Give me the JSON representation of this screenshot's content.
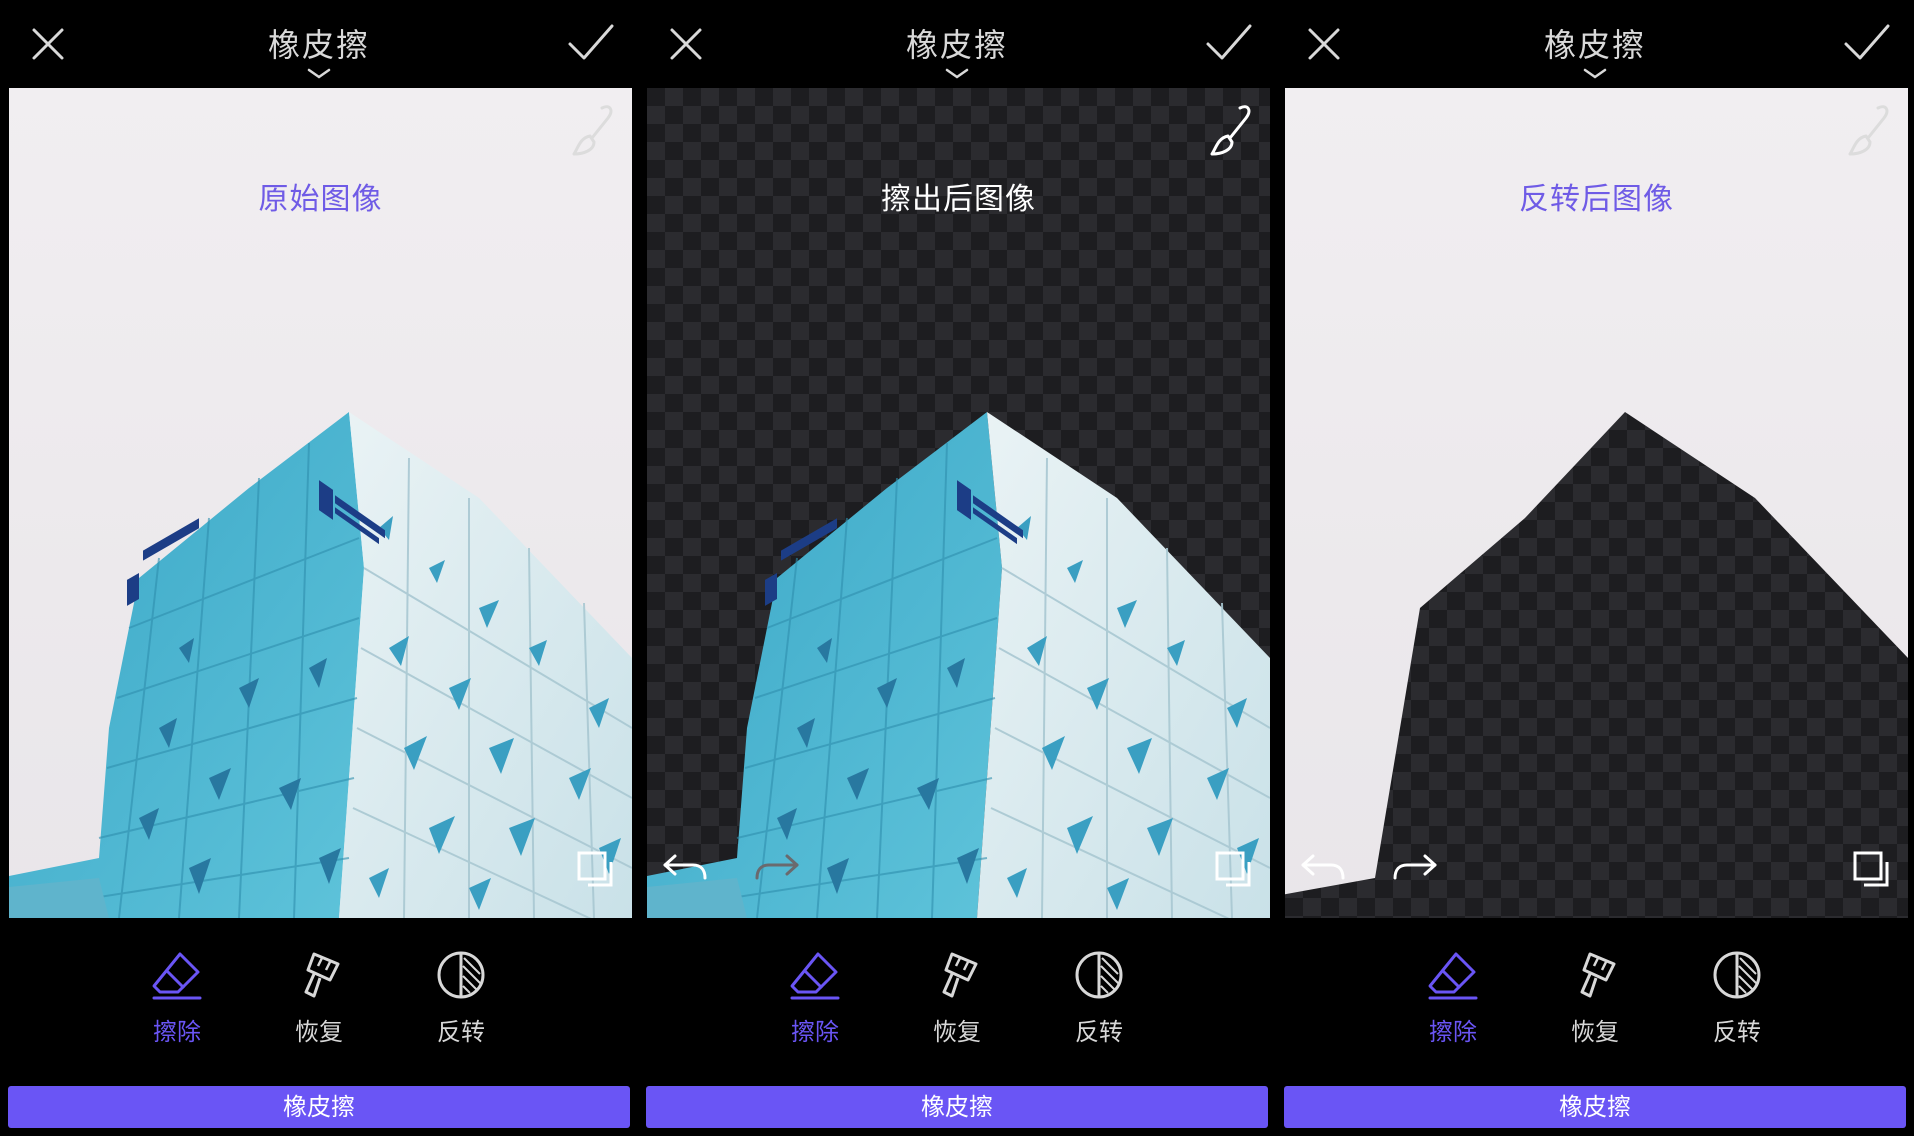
{
  "colors": {
    "accent": "#6a55f5",
    "label_purple": "#6f5be6",
    "icon_inactive": "#d8d8d8",
    "label_white": "#ffffff",
    "building_blue": "#4fb3cf",
    "building_light": "#d7e8ec"
  },
  "panels": [
    {
      "header_title": "橡皮擦",
      "canvas_label": "原始图像",
      "tools": [
        {
          "label": "擦除",
          "icon": "eraser-icon",
          "active": true
        },
        {
          "label": "恢复",
          "icon": "brush-restore-icon",
          "active": false
        },
        {
          "label": "反转",
          "icon": "invert-icon",
          "active": false
        }
      ],
      "bottom_label": "橡皮擦"
    },
    {
      "header_title": "橡皮擦",
      "canvas_label": "擦出后图像",
      "tools": [
        {
          "label": "擦除",
          "icon": "eraser-icon",
          "active": true
        },
        {
          "label": "恢复",
          "icon": "brush-restore-icon",
          "active": false
        },
        {
          "label": "反转",
          "icon": "invert-icon",
          "active": false
        }
      ],
      "bottom_label": "橡皮擦"
    },
    {
      "header_title": "橡皮擦",
      "canvas_label": "反转后图像",
      "tools": [
        {
          "label": "擦除",
          "icon": "eraser-icon",
          "active": true
        },
        {
          "label": "恢复",
          "icon": "brush-restore-icon",
          "active": false
        },
        {
          "label": "反转",
          "icon": "invert-icon",
          "active": false
        }
      ],
      "bottom_label": "橡皮擦"
    }
  ]
}
